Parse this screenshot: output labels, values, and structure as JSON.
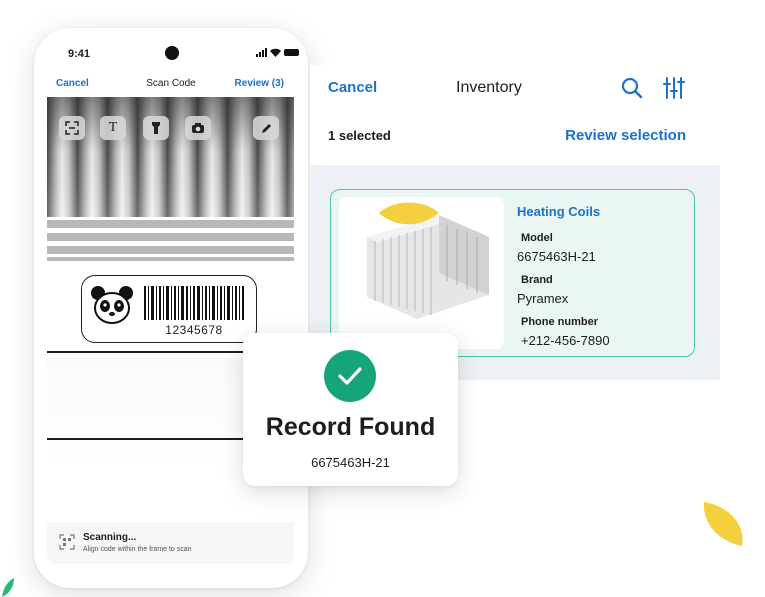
{
  "phone": {
    "status_time": "9:41",
    "nav": {
      "cancel": "Cancel",
      "title": "Scan Code",
      "review": "Review (3)"
    },
    "camera_tools": [
      "scan-frame-icon",
      "text-icon",
      "flashlight-icon",
      "camera-icon",
      "pen-icon"
    ],
    "barcode": {
      "number": "12345678"
    },
    "scanning": {
      "title": "Scanning...",
      "subtitle": "Align code within the frame to scan"
    }
  },
  "inventory": {
    "cancel": "Cancel",
    "title": "Inventory",
    "selected_count": "1 selected",
    "review_selection": "Review selection",
    "item": {
      "name": "Heating Coils",
      "fields": [
        {
          "label": "Model",
          "value": "6675463H-21"
        },
        {
          "label": "Brand",
          "value": "Pyramex"
        },
        {
          "label": "Phone number",
          "value": "+212-456-7890"
        }
      ]
    }
  },
  "record": {
    "title": "Record Found",
    "code": "6675463H-21"
  },
  "colors": {
    "accent_blue": "#1a73c9",
    "success_green": "#16a579",
    "card_border": "#4cc6a7",
    "leaf_green": "#2bb673",
    "leaf_yellow": "#f4d03f"
  }
}
